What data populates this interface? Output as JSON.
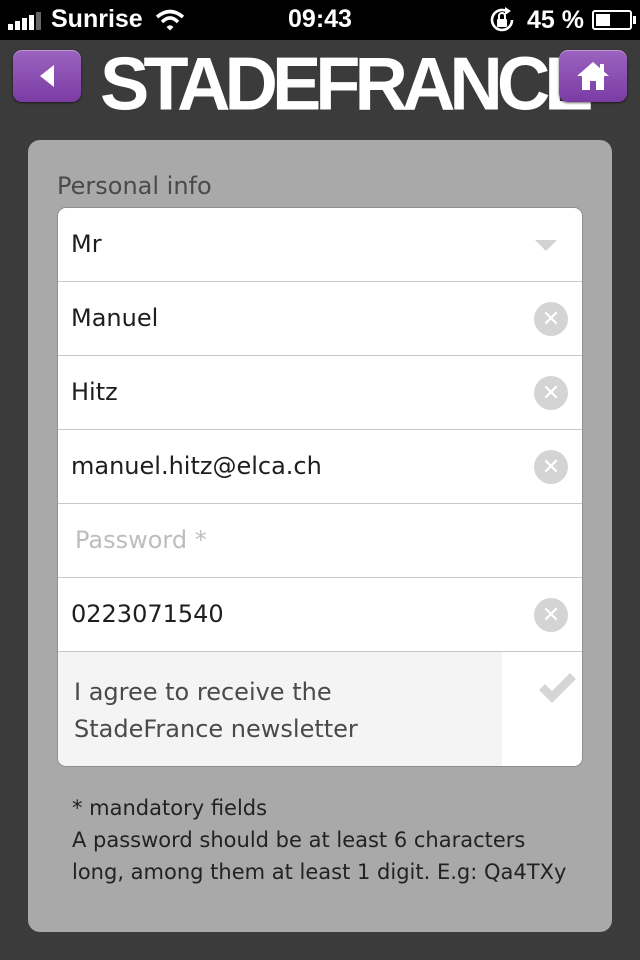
{
  "status_bar": {
    "carrier": "Sunrise",
    "time": "09:43",
    "battery": "45 %",
    "battery_level": 0.45,
    "icons": [
      "signal-icon",
      "wifi-icon",
      "rotation-lock-icon",
      "battery-icon"
    ]
  },
  "header": {
    "logo": "STADEFRANCE",
    "back_icon": "left-arrow-icon",
    "home_icon": "home-icon",
    "accent_color": "#8a4bb3"
  },
  "form": {
    "section_title": "Personal info",
    "title_select": {
      "value": "Mr"
    },
    "first_name": {
      "value": "Manuel"
    },
    "last_name": {
      "value": "Hitz"
    },
    "email": {
      "value": "manuel.hitz@elca.ch"
    },
    "password": {
      "value": "",
      "placeholder": "Password *"
    },
    "phone": {
      "value": "0223071540"
    },
    "newsletter": {
      "line1": "I agree to receive the",
      "line2": "StadeFrance newsletter",
      "checked": false
    }
  },
  "notes": {
    "mandatory": "* mandatory fields",
    "password_hint_1": "A password should be at least 6 characters",
    "password_hint_2": "long, among them at least 1 digit. E.g: Qa4TXy"
  }
}
